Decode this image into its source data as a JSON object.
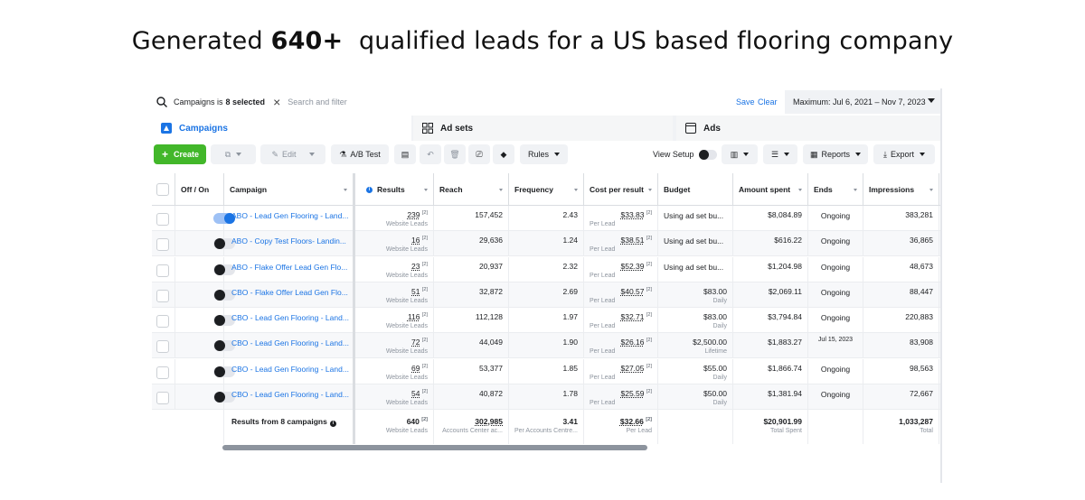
{
  "headline": {
    "before": "Generated ",
    "bold": "640+",
    "after": "  qualified leads for a US based flooring company"
  },
  "search": {
    "filter_label": "Campaigns is",
    "filter_value": "8 selected",
    "placeholder": "Search and filter",
    "save": "Save",
    "clear": "Clear",
    "date_range": "Maximum: Jul 6, 2021 – Nov 7, 2023"
  },
  "tabs": [
    {
      "label": "Campaigns",
      "icon": "campaigns-icon"
    },
    {
      "label": "Ad sets",
      "icon": "grid-icon"
    },
    {
      "label": "Ads",
      "icon": "ad-icon"
    }
  ],
  "toolbar": {
    "create": "Create",
    "edit": "Edit",
    "ab_test": "A/B Test",
    "rules": "Rules",
    "view_setup": "View Setup",
    "reports": "Reports",
    "export": "Export"
  },
  "columns": {
    "off_on": "Off / On",
    "campaign": "Campaign",
    "results": "Results",
    "reach": "Reach",
    "frequency": "Frequency",
    "cost_per_result": "Cost per result",
    "budget": "Budget",
    "amount_spent": "Amount spent",
    "ends": "Ends",
    "impressions": "Impressions"
  },
  "rows": [
    {
      "on": true,
      "campaign": "ABO - Lead Gen Flooring - Land...",
      "results": "239",
      "results_sub": "Website Leads",
      "reach": "157,452",
      "frequency": "2.43",
      "cpr": "$33.83",
      "cpr_sub": "Per Lead",
      "budget": "Using ad set bu...",
      "budget_sub": "",
      "spent": "$8,084.89",
      "ends": "Ongoing",
      "impressions": "383,281"
    },
    {
      "on": false,
      "campaign": "ABO - Copy Test Floors- Landin...",
      "results": "16",
      "results_sub": "Website Leads",
      "reach": "29,636",
      "frequency": "1.24",
      "cpr": "$38.51",
      "cpr_sub": "Per Lead",
      "budget": "Using ad set bu...",
      "budget_sub": "",
      "spent": "$616.22",
      "ends": "Ongoing",
      "impressions": "36,865"
    },
    {
      "on": false,
      "campaign": "ABO - Flake Offer Lead Gen Flo...",
      "results": "23",
      "results_sub": "Website Leads",
      "reach": "20,937",
      "frequency": "2.32",
      "cpr": "$52.39",
      "cpr_sub": "Per Lead",
      "budget": "Using ad set bu...",
      "budget_sub": "",
      "spent": "$1,204.98",
      "ends": "Ongoing",
      "impressions": "48,673"
    },
    {
      "on": false,
      "campaign": "CBO - Flake Offer Lead Gen Flo...",
      "results": "51",
      "results_sub": "Website Leads",
      "reach": "32,872",
      "frequency": "2.69",
      "cpr": "$40.57",
      "cpr_sub": "Per Lead",
      "budget": "$83.00",
      "budget_sub": "Daily",
      "spent": "$2,069.11",
      "ends": "Ongoing",
      "impressions": "88,447"
    },
    {
      "on": false,
      "campaign": "CBO - Lead Gen Flooring - Land...",
      "results": "116",
      "results_sub": "Website Leads",
      "reach": "112,128",
      "frequency": "1.97",
      "cpr": "$32.71",
      "cpr_sub": "Per Lead",
      "budget": "$83.00",
      "budget_sub": "Daily",
      "spent": "$3,794.84",
      "ends": "Ongoing",
      "impressions": "220,883"
    },
    {
      "on": false,
      "campaign": "CBO - Lead Gen Flooring - Land...",
      "results": "72",
      "results_sub": "Website Leads",
      "reach": "44,049",
      "frequency": "1.90",
      "cpr": "$26.16",
      "cpr_sub": "Per Lead",
      "budget": "$2,500.00",
      "budget_sub": "Lifetime",
      "spent": "$1,883.27",
      "ends": "Jul 15, 2023",
      "impressions": "83,908"
    },
    {
      "on": false,
      "campaign": "CBO - Lead Gen Flooring - Land...",
      "results": "69",
      "results_sub": "Website Leads",
      "reach": "53,377",
      "frequency": "1.85",
      "cpr": "$27.05",
      "cpr_sub": "Per Lead",
      "budget": "$55.00",
      "budget_sub": "Daily",
      "spent": "$1,866.74",
      "ends": "Ongoing",
      "impressions": "98,563"
    },
    {
      "on": false,
      "campaign": "CBO - Lead Gen Flooring - Land...",
      "results": "54",
      "results_sub": "Website Leads",
      "reach": "40,872",
      "frequency": "1.78",
      "cpr": "$25.59",
      "cpr_sub": "Per Lead",
      "budget": "$50.00",
      "budget_sub": "Daily",
      "spent": "$1,381.94",
      "ends": "Ongoing",
      "impressions": "72,667"
    }
  ],
  "totals": {
    "label": "Results from 8 campaigns",
    "results": "640",
    "results_sub": "Website Leads",
    "reach": "302,985",
    "reach_sub": "Accounts Center ac...",
    "frequency": "3.41",
    "frequency_sub": "Per Accounts Centre...",
    "cpr": "$32.66",
    "cpr_sub": "Per Lead",
    "spent": "$20,901.99",
    "spent_sub": "Total Spent",
    "impressions": "1,033,287",
    "impressions_sub": "Total"
  },
  "colors": {
    "accent": "#1b74e4",
    "create_green": "#42b72a"
  }
}
